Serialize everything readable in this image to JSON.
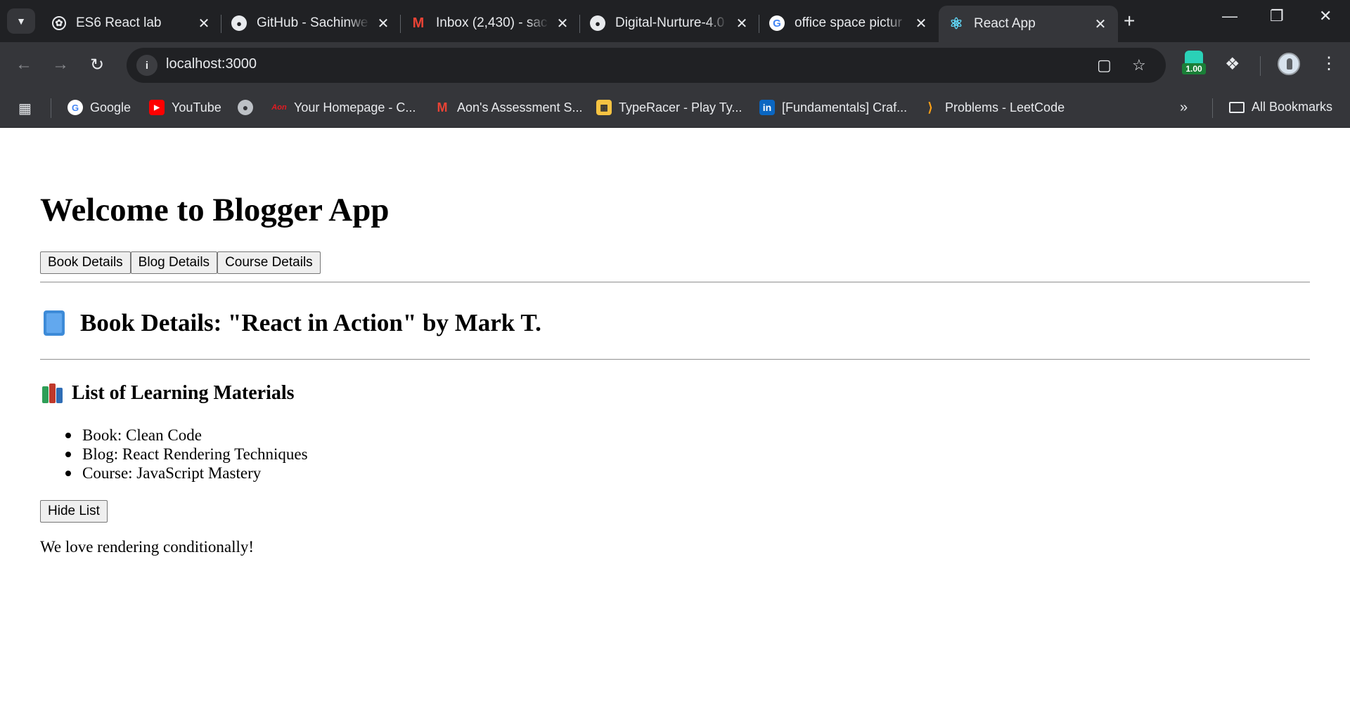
{
  "browser": {
    "tabs": [
      {
        "title": "ES6 React lab",
        "favicon": "openai-icon",
        "active": false
      },
      {
        "title": "GitHub - Sachinwe",
        "favicon": "github-icon",
        "active": false
      },
      {
        "title": "Inbox (2,430) - sac",
        "favicon": "gmail-icon",
        "active": false
      },
      {
        "title": "Digital-Nurture-4.0",
        "favicon": "github-icon",
        "active": false
      },
      {
        "title": "office space pictur",
        "favicon": "google-icon",
        "active": false
      },
      {
        "title": "React App",
        "favicon": "react-icon",
        "active": true
      }
    ],
    "url": "localhost:3000",
    "extension_badge": "1.00",
    "bookmarks": [
      {
        "label": "Google",
        "icon": "google-icon"
      },
      {
        "label": "YouTube",
        "icon": "youtube-icon"
      },
      {
        "label": "",
        "icon": "globe-icon"
      },
      {
        "label": "Your Homepage - C...",
        "icon": "aon-icon"
      },
      {
        "label": "Aon's Assessment S...",
        "icon": "gmail-icon"
      },
      {
        "label": "TypeRacer - Play Ty...",
        "icon": "typeracer-icon"
      },
      {
        "label": "[Fundamentals] Craf...",
        "icon": "linkedin-icon"
      },
      {
        "label": "Problems - LeetCode",
        "icon": "leetcode-icon"
      }
    ],
    "all_bookmarks_label": "All Bookmarks"
  },
  "app": {
    "title": "Welcome to Blogger App",
    "buttons": {
      "book": "Book Details",
      "blog": "Blog Details",
      "course": "Course Details"
    },
    "book_heading": "Book Details: \"React in Action\" by Mark T.",
    "list_heading": "List of Learning Materials",
    "materials": [
      "Book: Clean Code",
      "Blog: React Rendering Techniques",
      "Course: JavaScript Mastery"
    ],
    "hide_button": "Hide List",
    "tagline": "We love rendering conditionally!"
  }
}
